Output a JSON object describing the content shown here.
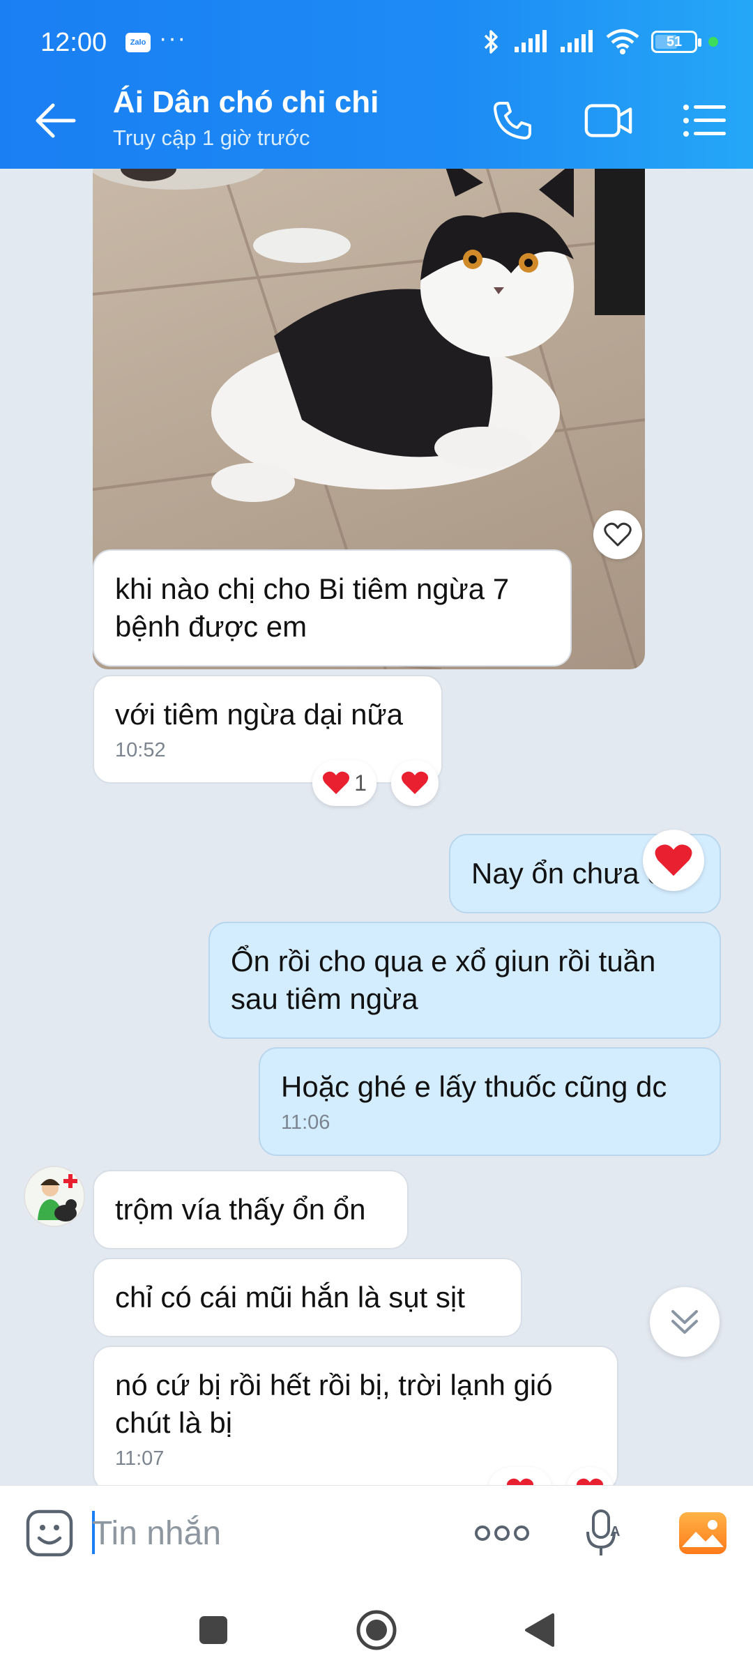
{
  "status_bar": {
    "time": "12:00",
    "app_badge": "Zalo",
    "dots": "···",
    "battery": "51"
  },
  "header": {
    "contact_name": "Ái Dân chó chi chi",
    "contact_status": "Truy cập 1 giờ trước"
  },
  "messages": [
    {
      "side": "in",
      "text": "khi nào chị cho Bi tiêm ngừa 7 bệnh được em"
    },
    {
      "side": "in",
      "text": "với tiêm ngừa dại nữa",
      "time": "10:52",
      "reaction_count": "1"
    },
    {
      "side": "out",
      "text": "Nay ổn chưa chị"
    },
    {
      "side": "out",
      "text": "Ổn rồi cho qua e xổ giun rồi tuần sau tiêm ngừa"
    },
    {
      "side": "out",
      "text": "Hoặc ghé e lấy thuốc cũng dc",
      "time": "11:06"
    },
    {
      "side": "in",
      "text": "trộm vía thấy ổn ổn"
    },
    {
      "side": "in",
      "text": "chỉ có cái mũi hắn là sụt sịt"
    },
    {
      "side": "in",
      "text": "nó cứ bị rồi hết rồi bị, trời lạnh gió chút là bị",
      "time": "11:07"
    }
  ],
  "input": {
    "placeholder": "Tin nhắn"
  },
  "colors": {
    "header_blue": "#1a7ff3",
    "outgoing_bubble": "#d3ecfe",
    "chat_background": "#e3e9f1",
    "heart_red": "#e8202f"
  },
  "icons": [
    "back-arrow-icon",
    "phone-icon",
    "video-call-icon",
    "menu-list-icon",
    "heart-icon",
    "sticker-icon",
    "more-icon",
    "voice-text-icon",
    "image-icon",
    "chevron-double-down-icon",
    "nav-recent-icon",
    "nav-home-icon",
    "nav-back-icon"
  ]
}
